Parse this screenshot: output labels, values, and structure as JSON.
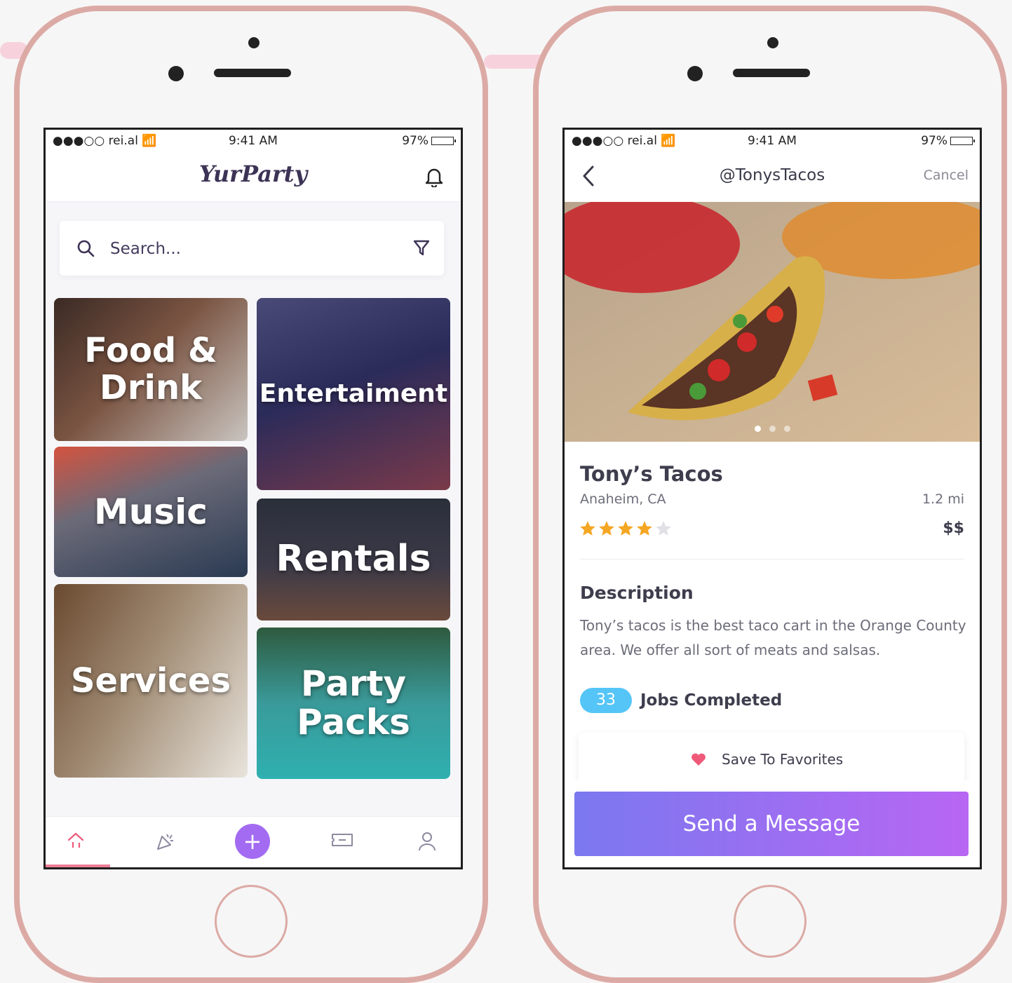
{
  "status_bar": {
    "carrier": "●●●○○ rei.al",
    "time": "9:41 AM",
    "battery": "97%"
  },
  "home_screen": {
    "logo": "YurParty",
    "search": {
      "placeholder": "Search..."
    },
    "categories": [
      {
        "label": "Food & Drink"
      },
      {
        "label": "Entertaiment"
      },
      {
        "label": "Music"
      },
      {
        "label": "Rentals"
      },
      {
        "label": "Services"
      },
      {
        "label": "Party Packs"
      }
    ],
    "tab_icons": [
      "home-icon",
      "party-popper-icon",
      "plus-icon",
      "ticket-icon",
      "profile-icon"
    ],
    "active_tab": "home",
    "plus_symbol": "+"
  },
  "detail_screen": {
    "handle": "@TonysTacos",
    "cancel_label": "Cancel",
    "business_name": "Tony’s Tacos",
    "location": "Anaheim, CA",
    "distance": "1.2 mi",
    "rating": 4,
    "rating_max": 5,
    "price_level": "$$",
    "description_heading": "Description",
    "description": "Tony’s tacos is the best taco cart in the Orange County area. We offer all sort of meats and salsas.",
    "jobs_count": "33",
    "jobs_label": "Jobs Completed",
    "favorites_label": "Save To Favorites",
    "send_label": "Send a Message",
    "carousel": {
      "total": 3,
      "active": 1
    }
  },
  "colors": {
    "phone_frame": "#dcaaa5",
    "accent_purple": "#a36bf2",
    "button_gradient_start": "#7b78ef",
    "button_gradient_end": "#b866f3",
    "badge_blue": "#55c5f7",
    "star_gold": "#f5a623",
    "heart_pink": "#ef5a7a",
    "tab_indicator": "#ef7d96"
  }
}
